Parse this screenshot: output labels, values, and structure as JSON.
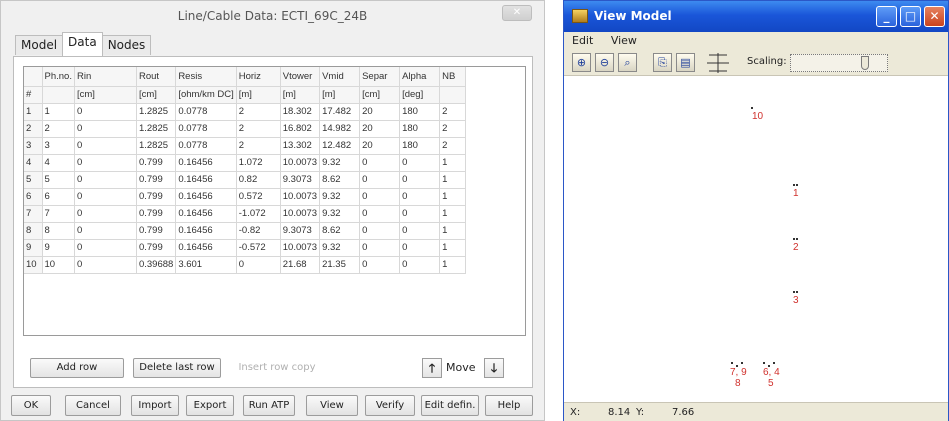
{
  "dialog": {
    "title": "Line/Cable Data: ECTI_69C_24B",
    "close_glyph": "✕",
    "tabs": [
      {
        "label": "Model",
        "active": false
      },
      {
        "label": "Data",
        "active": true
      },
      {
        "label": "Nodes",
        "active": false
      }
    ],
    "columns": [
      "#",
      "Ph.no.",
      "Rin",
      "Rout",
      "Resis",
      "Horiz",
      "Vtower",
      "Vmid",
      "Separ",
      "Alpha",
      "NB"
    ],
    "units": [
      "#",
      "",
      "[cm]",
      "[cm]",
      "[ohm/km DC]",
      "[m]",
      "[m]",
      "[m]",
      "[cm]",
      "[deg]",
      ""
    ],
    "rows": [
      [
        "1",
        "1",
        "0",
        "1.2825",
        "0.0778",
        "2",
        "18.302",
        "17.482",
        "20",
        "180",
        "2"
      ],
      [
        "2",
        "2",
        "0",
        "1.2825",
        "0.0778",
        "2",
        "16.802",
        "14.982",
        "20",
        "180",
        "2"
      ],
      [
        "3",
        "3",
        "0",
        "1.2825",
        "0.0778",
        "2",
        "13.302",
        "12.482",
        "20",
        "180",
        "2"
      ],
      [
        "4",
        "4",
        "0",
        "0.799",
        "0.16456",
        "1.072",
        "10.0073",
        "9.32",
        "0",
        "0",
        "1"
      ],
      [
        "5",
        "5",
        "0",
        "0.799",
        "0.16456",
        "0.82",
        "9.3073",
        "8.62",
        "0",
        "0",
        "1"
      ],
      [
        "6",
        "6",
        "0",
        "0.799",
        "0.16456",
        "0.572",
        "10.0073",
        "9.32",
        "0",
        "0",
        "1"
      ],
      [
        "7",
        "7",
        "0",
        "0.799",
        "0.16456",
        "-1.072",
        "10.0073",
        "9.32",
        "0",
        "0",
        "1"
      ],
      [
        "8",
        "8",
        "0",
        "0.799",
        "0.16456",
        "-0.82",
        "9.3073",
        "8.62",
        "0",
        "0",
        "1"
      ],
      [
        "9",
        "9",
        "0",
        "0.799",
        "0.16456",
        "-0.572",
        "10.0073",
        "9.32",
        "0",
        "0",
        "1"
      ],
      [
        "10",
        "10",
        "0",
        "0.39688",
        "3.601",
        "0",
        "21.68",
        "21.35",
        "0",
        "0",
        "1"
      ]
    ],
    "panel_buttons": {
      "add_row": "Add row",
      "delete_last_row": "Delete last row",
      "insert_row_copy": "Insert row copy",
      "move_label": "Move",
      "move_up_glyph": "🡑",
      "move_down_glyph": "🡓"
    },
    "buttons": {
      "ok": "OK",
      "cancel": "Cancel",
      "import": "Import",
      "export": "Export",
      "run_atp": "Run ATP",
      "view": "View",
      "verify": "Verify",
      "edit_defin": "Edit defin.",
      "help": "Help"
    }
  },
  "view_window": {
    "title": "View Model",
    "menu": [
      "Edit",
      "View"
    ],
    "toolbar": {
      "icons": [
        "zoom-in-icon",
        "zoom-out-icon",
        "zoom-fit-icon",
        "copy-icon",
        "paste-icon",
        "grid-icon"
      ],
      "scaling_label": "Scaling:"
    },
    "win_controls": {
      "minimize": "_",
      "maximize": "□",
      "close": "✕"
    },
    "nodes": [
      {
        "label": "10"
      },
      {
        "label": "1"
      },
      {
        "label": "2"
      },
      {
        "label": "3"
      },
      {
        "label": "7, 9"
      },
      {
        "label": "8"
      },
      {
        "label": "6, 4"
      },
      {
        "label": "5"
      }
    ],
    "status": {
      "x_label": "X:",
      "x_value": "8.14",
      "y_label": "Y:",
      "y_value": "7.66"
    }
  }
}
